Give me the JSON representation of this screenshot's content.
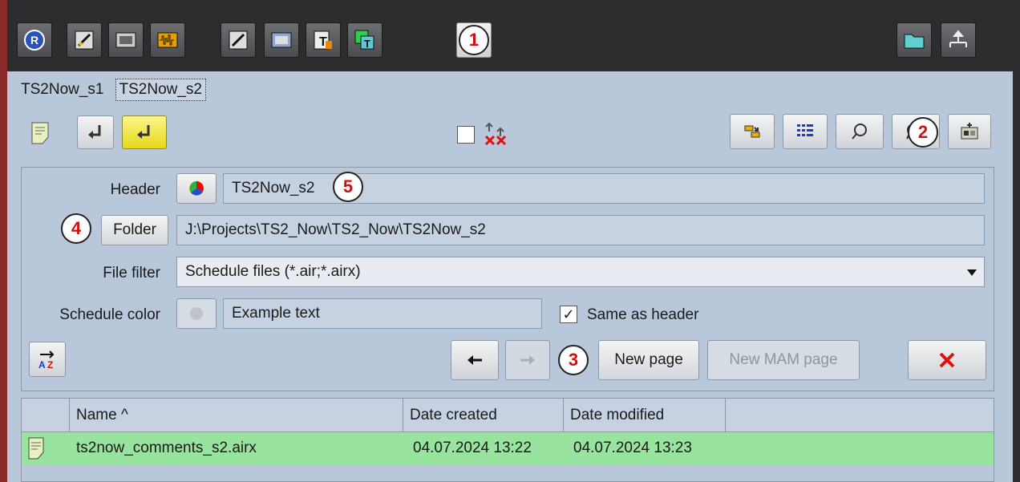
{
  "toolbar_top": {
    "icons": [
      "r-logo-icon",
      "edit-icon",
      "film-icon",
      "audio-waveform-icon",
      "edit-image-icon",
      "film-edit-icon",
      "text-template-icon",
      "text-layers-icon",
      "note-icon",
      "folder-icon",
      "network-icon"
    ]
  },
  "badges": {
    "b1": "1",
    "b2": "2",
    "b3": "3",
    "b4": "4",
    "b5": "5"
  },
  "tabs": [
    {
      "label": "TS2Now_s1"
    },
    {
      "label": "TS2Now_s2"
    }
  ],
  "form": {
    "header_label": "Header",
    "header_value": "TS2Now_s2",
    "folder_button": "Folder",
    "folder_value": "J:\\Projects\\TS2_Now\\TS2_Now\\TS2Now_s2",
    "file_filter_label": "File filter",
    "file_filter_value": "Schedule files (*.air;*.airx)",
    "schedule_color_label": "Schedule color",
    "schedule_color_value": "Example text",
    "same_as_header_label": "Same as header",
    "same_as_header_checked": "✓",
    "new_page": "New page",
    "new_mam_page": "New MAM page"
  },
  "table": {
    "columns": [
      "Name ^",
      "Date created",
      "Date modified"
    ],
    "rows": [
      {
        "name": "ts2now_comments_s2.airx",
        "created": "04.07.2024 13:22",
        "modified": "04.07.2024 13:23"
      }
    ]
  },
  "colors": {
    "selected_row": "#98e39d",
    "panel_bg": "#b9c7da",
    "topbar_bg": "#2d2d30",
    "badge_text": "#d01010"
  }
}
